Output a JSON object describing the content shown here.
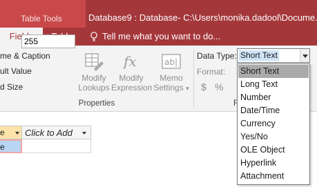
{
  "titlebar": {
    "tool_tools": "Table Tools",
    "title": "Database9 : Database- C:\\Users\\monika.dadool\\Docume..."
  },
  "tabs": [
    {
      "label": "Fields",
      "active": true
    },
    {
      "label": "Table",
      "active": false
    }
  ],
  "tell_me": "Tell me what you want to do...",
  "ribbon": {
    "name_caption": "me & Caption",
    "default_value": "ult Value",
    "field_size_label": "d Size",
    "field_size_value": "255",
    "modify_lookups": [
      "Modify",
      "Lookups"
    ],
    "modify_expression": [
      "Modify",
      "Expression"
    ],
    "memo_settings": [
      "Memo",
      "Settings"
    ],
    "properties_group": "Properties",
    "data_type_label": "Data Type:",
    "data_type_value": "Short Text",
    "format_label": "Format:",
    "format_group": "F"
  },
  "grid": {
    "col1_header": "e",
    "col2_header": "Click to Add",
    "row1_col1": "e"
  },
  "data_type_options": [
    "Short Text",
    "Long Text",
    "Number",
    "Date/Time",
    "Currency",
    "Yes/No",
    "OLE Object",
    "Hyperlink",
    "Attachment"
  ],
  "selected_option": "Short Text",
  "colors": {
    "accent": "#a4373a",
    "tool_tab": "#c9484a",
    "selection": "#aaaaaa"
  }
}
